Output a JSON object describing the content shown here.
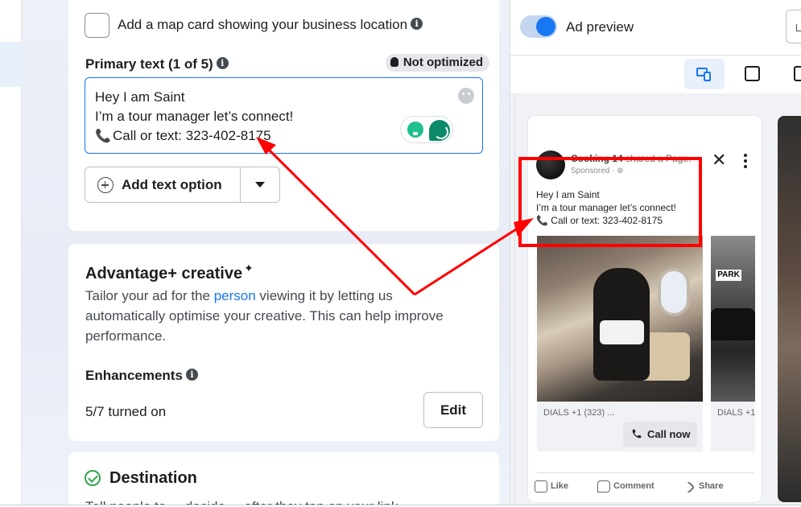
{
  "colors": {
    "accent": "#1877f2",
    "annotation_red": "#ff0000",
    "success_green": "#31a24c"
  },
  "map_card": {
    "label": "Add a map card showing your business location",
    "info_icon": "info-icon"
  },
  "primary_text": {
    "label": "Primary text (1 of 5)",
    "badge": "Not optimized",
    "lines": [
      "Hey I am Saint",
      "I’m a tour manager let’s connect!",
      "Call or text: 323-402-8175"
    ],
    "phone_emoji": "📞"
  },
  "add_text_option": {
    "label": "Add text option"
  },
  "advantage": {
    "title": "Advantage+ creative",
    "sparkle": "✦",
    "desc_before": "Tailor your ad for the ",
    "desc_link": "person",
    "desc_after": " viewing it by letting us automatically optimise your creative. This can help improve performance.",
    "enhancements_label": "Enhancements",
    "enhancements_count": "5/7 turned on",
    "edit_label": "Edit"
  },
  "destination": {
    "title": "Destination",
    "desc_cut": "Tell people to ... decide ... after they tap on your link"
  },
  "preview": {
    "toggle_label": "Ad preview",
    "page_name": "Cooking 14",
    "shared_text": " shared a Page.",
    "sponsored": "Sponsored · ⊕",
    "close_glyph": "✕",
    "ad_lines": [
      "Hey I am Saint",
      "I’m a tour manager let’s connect!",
      "Call or text: 323-402-8175"
    ],
    "phone_glyph": "📞",
    "card1_caption": "DIALS +1 (323) ...",
    "card2_caption": "DIALS +1",
    "cta_label": "Call now",
    "park_sign": "PARK",
    "actions": {
      "like": "Like",
      "comment": "Comment",
      "share": "Share"
    }
  }
}
